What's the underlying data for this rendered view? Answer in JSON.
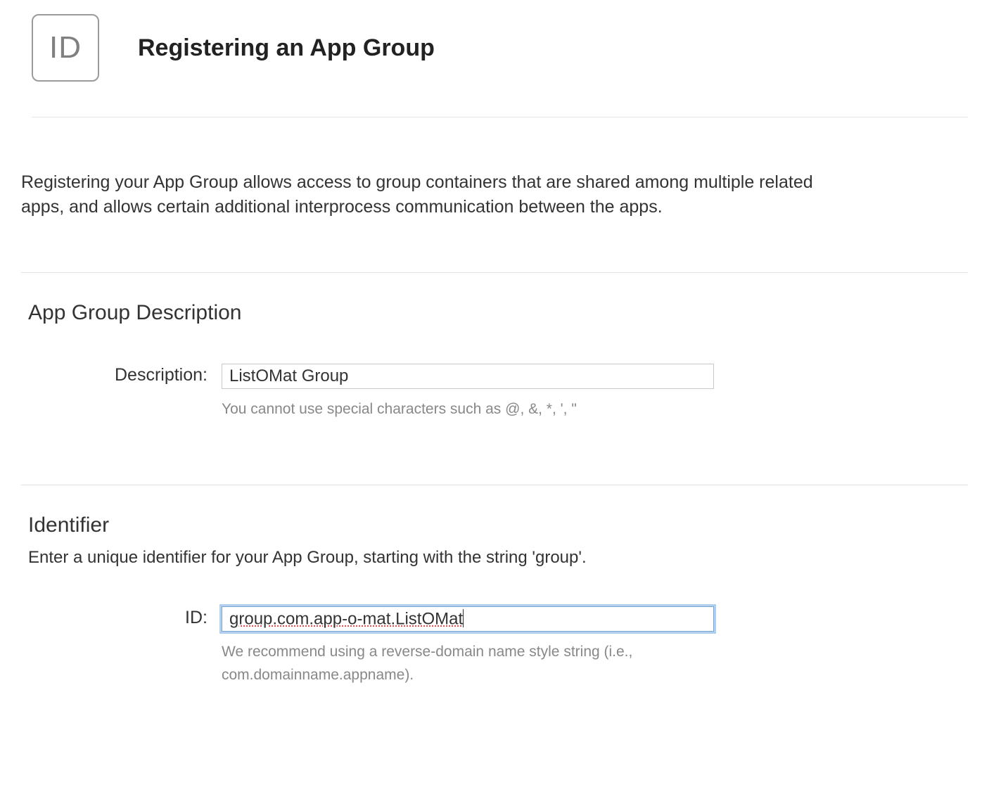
{
  "header": {
    "icon_text": "ID",
    "title": "Registering an App Group"
  },
  "intro": "Registering your App Group allows access to group containers that are shared among multiple related apps, and allows certain additional interprocess communication between the apps.",
  "sections": {
    "description": {
      "title": "App Group Description",
      "field_label": "Description:",
      "value": "ListOMat Group",
      "hint": "You cannot use special characters such as @, &, *, ', \""
    },
    "identifier": {
      "title": "Identifier",
      "subtitle": "Enter a unique identifier for your App Group, starting with the string 'group'.",
      "field_label": "ID:",
      "value": "group.com.app-o-mat.ListOMat",
      "hint": "We recommend using a reverse-domain name style string (i.e., com.domainname.appname)."
    }
  }
}
